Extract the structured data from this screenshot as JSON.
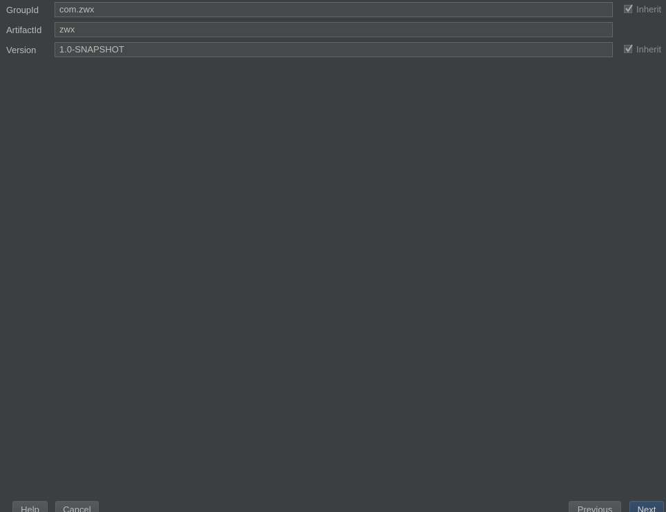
{
  "form": {
    "group_id": {
      "label": "GroupId",
      "value": "com.zwx",
      "inherit_label": "Inherit",
      "inherit_checked": true
    },
    "artifact_id": {
      "label": "ArtifactId",
      "value": "zwx"
    },
    "version": {
      "label": "Version",
      "value": "1.0-SNAPSHOT",
      "inherit_label": "Inherit",
      "inherit_checked": true
    }
  },
  "footer": {
    "help_label": "Help",
    "cancel_label": "Cancel",
    "previous_label": "Previous",
    "next_label": "Next"
  },
  "icons": {
    "checkbox_check": "check-icon"
  },
  "colors": {
    "background": "#3c3f41",
    "field_background": "#45494a",
    "field_border": "#646464",
    "text": "#bbbbbb",
    "primary_button": "#384f6b"
  }
}
